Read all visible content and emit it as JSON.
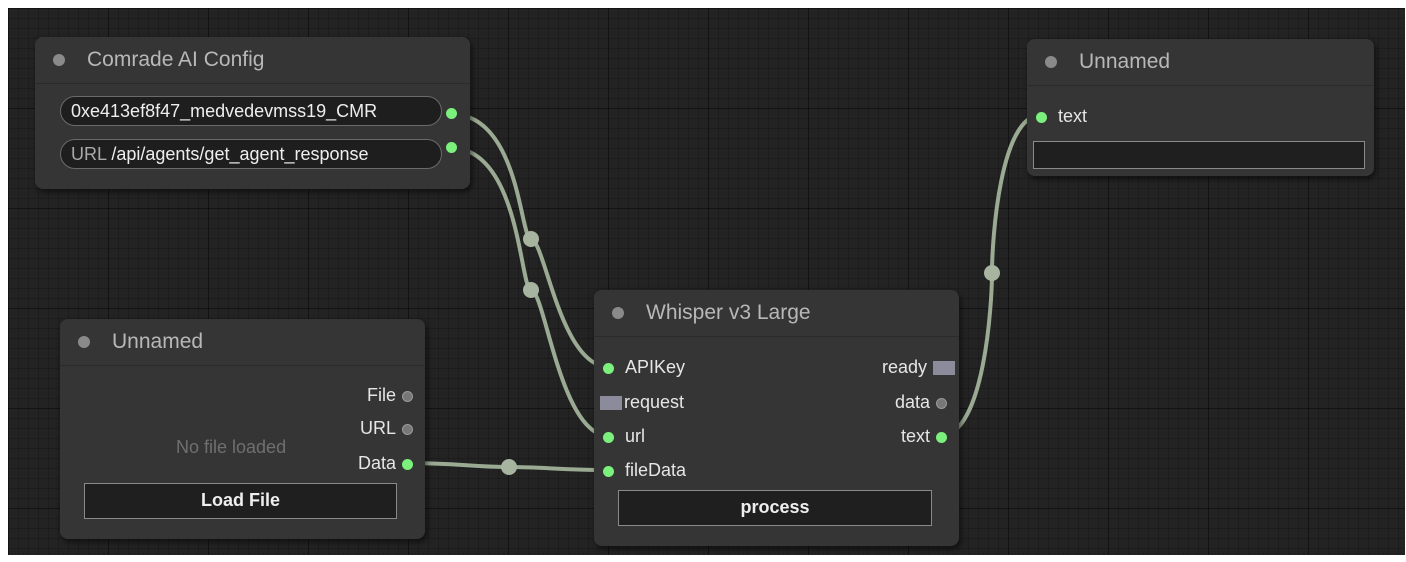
{
  "nodes": {
    "config": {
      "title": "Comrade AI Config",
      "api_key_value": "0xe413ef8f47_medvedevmss19_CMR",
      "url_label": "URL",
      "url_value": "/api/agents/get_agent_response"
    },
    "output": {
      "title": "Unnamed",
      "input_text": "text",
      "textbox_value": ""
    },
    "loader": {
      "title": "Unnamed",
      "out_file": "File",
      "out_url": "URL",
      "out_data": "Data",
      "status": "No file loaded",
      "button": "Load File"
    },
    "whisper": {
      "title": "Whisper v3 Large",
      "in_apikey": "APIKey",
      "in_request": "request",
      "in_url": "url",
      "in_filedata": "fileData",
      "out_ready": "ready",
      "out_data": "data",
      "out_text": "text",
      "button": "process"
    }
  },
  "colors": {
    "canvas": "#232323",
    "node_bg": "#353535",
    "link": "#9aaa93",
    "slot_connected": "#7cf07c",
    "slot_event": "#8b8b9c"
  }
}
